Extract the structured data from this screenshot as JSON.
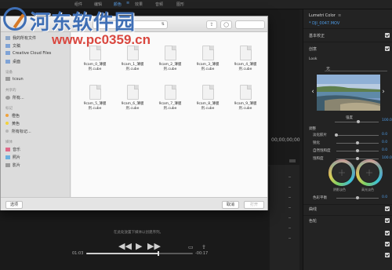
{
  "workspaces": {
    "items": [
      "组件",
      "编辑",
      "颜色",
      "效果",
      "音频",
      "图形"
    ],
    "active_index": 2,
    "active_menu_icon": "menu-lines-icon"
  },
  "monitor": {
    "timecode": "00;00;00;00",
    "hint": "在此处放置下媒体以创建序列。",
    "time_current": "01:03",
    "time_remaining": "-00:17",
    "progress": 0.68
  },
  "dialog": {
    "folder_select": "",
    "sidebar": {
      "top_items": [
        {
          "label": "我的所有文件",
          "icon": "all-files-icon"
        },
        {
          "label": "文稿",
          "icon": "folder-icon"
        },
        {
          "label": "Creative Cloud Files",
          "icon": "cloud-folder-icon"
        },
        {
          "label": "桌面",
          "icon": "folder-icon"
        }
      ],
      "section_devices": "设备",
      "devices": [
        {
          "label": "tcsun",
          "icon": "computer-icon"
        }
      ],
      "section_shared": "共享的",
      "shared": [
        {
          "label": "所有...",
          "icon": "network-icon"
        }
      ],
      "section_tags": "标记",
      "tags": [
        {
          "label": "橙色",
          "color": "#f0a23b"
        },
        {
          "label": "黄色",
          "color": "#f2d23a"
        },
        {
          "label": "所有标记...",
          "color": "#b5b5b5"
        }
      ],
      "section_media": "媒体",
      "media": [
        {
          "label": "音乐",
          "icon": "music-icon"
        },
        {
          "label": "照片",
          "icon": "photos-icon"
        },
        {
          "label": "影片",
          "icon": "movies-icon"
        }
      ]
    },
    "files": [
      {
        "line1": "9cam_0_薄膜",
        "line2": "剂.cube"
      },
      {
        "line1": "9cam_1_薄膜",
        "line2": "剂.cube"
      },
      {
        "line1": "9cam_2_薄膜",
        "line2": "剂.cube"
      },
      {
        "line1": "9cam_3_薄膜",
        "line2": "剂.cube"
      },
      {
        "line1": "9cam_4_薄膜",
        "line2": "剂.cube"
      },
      {
        "line1": "9cam_5_薄膜",
        "line2": "剂.cube"
      },
      {
        "line1": "9cam_6_薄膜",
        "line2": "剂.cube"
      },
      {
        "line1": "9cam_7_薄膜",
        "line2": "剂.cube"
      },
      {
        "line1": "9cam_8_薄膜",
        "line2": "剂.cube"
      },
      {
        "line1": "9cam_9_薄膜",
        "line2": "剂.cube"
      }
    ],
    "options_button": "选项",
    "cancel_button": "取消",
    "open_button": "打开"
  },
  "lumetri": {
    "title": "Lumetri Color",
    "clip": "* DJI_0047.MOV",
    "basic_correction": "基本校正",
    "creative": "创意",
    "look_label": "Look",
    "look_value": "无",
    "intensity_label": "强度",
    "intensity_value": "100.0",
    "adjust": "调整",
    "sliders": [
      {
        "label": "淡化胶片",
        "value": "0.0",
        "position": 0.0
      },
      {
        "label": "锐化",
        "value": "0.0",
        "position": 0.5
      },
      {
        "label": "自然饱和度",
        "value": "0.0",
        "position": 0.5
      },
      {
        "label": "饱和度",
        "value": "100.0",
        "position": 0.5
      }
    ],
    "wheel_left": "阴影淡色",
    "wheel_right": "高光淡色",
    "tint_balance": "色彩平衡",
    "tint_balance_value": "0.0",
    "curves": "曲线",
    "color_wheels": "色轮"
  },
  "watermark": {
    "title": "河东软件园",
    "url": "www.pc0359.cn"
  }
}
